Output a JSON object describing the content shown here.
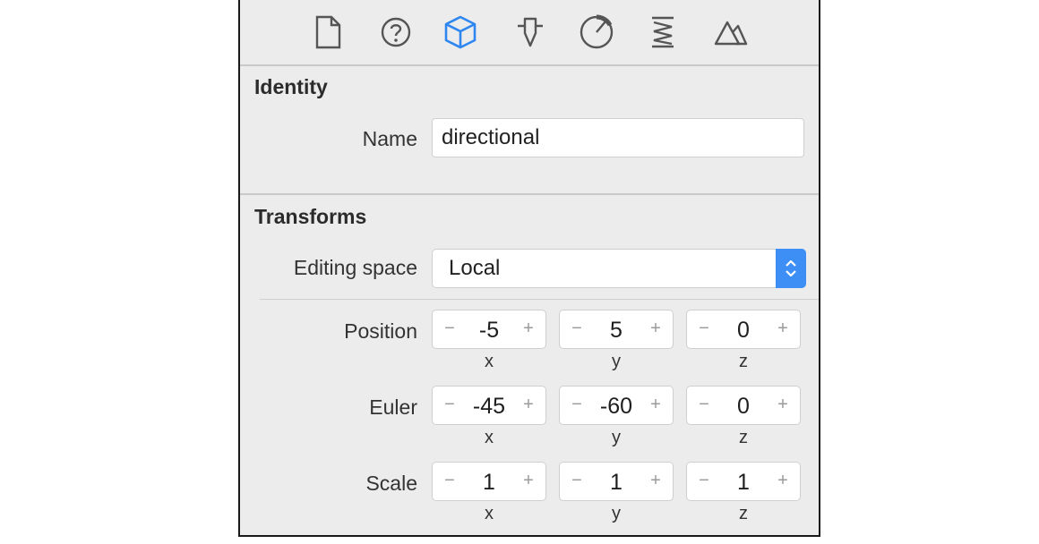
{
  "toolbar": {
    "icons": [
      "file-icon",
      "help-icon",
      "node-cube-icon",
      "attributes-icon",
      "physics-icon",
      "constraints-icon",
      "scene-icon"
    ]
  },
  "identity": {
    "title": "Identity",
    "name_label": "Name",
    "name_value": "directional"
  },
  "transforms": {
    "title": "Transforms",
    "editing_space_label": "Editing space",
    "editing_space_value": "Local",
    "position": {
      "label": "Position",
      "x": "-5",
      "y": "5",
      "z": "0"
    },
    "euler": {
      "label": "Euler",
      "x": "-45",
      "y": "-60",
      "z": "0"
    },
    "scale": {
      "label": "Scale",
      "x": "1",
      "y": "1",
      "z": "1"
    },
    "axis_labels": {
      "x": "x",
      "y": "y",
      "z": "z"
    },
    "minus": "−",
    "plus": "+"
  },
  "colors": {
    "accent": "#3d8ef5",
    "panel": "#ececec"
  }
}
